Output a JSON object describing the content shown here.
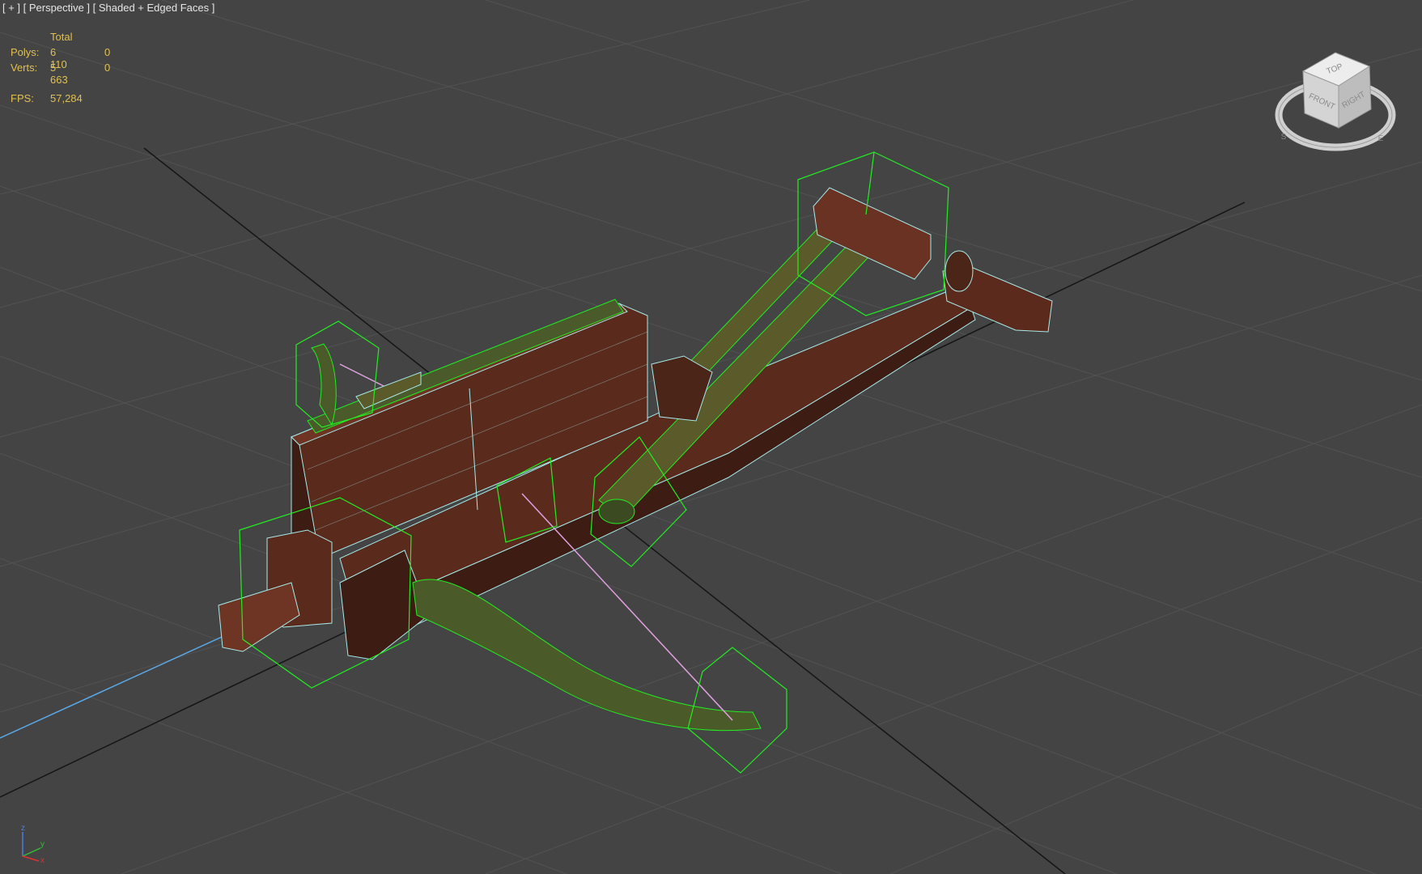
{
  "viewport": {
    "label": "[ + ] [ Perspective ] [ Shaded + Edged Faces ]",
    "label_parts": [
      "[ + ]",
      "[ Perspective ]",
      "[ Shaded + Edged Faces ]"
    ]
  },
  "stats": {
    "header": "Total",
    "polys_label": "Polys:",
    "polys_total": "6 110",
    "polys_selected": "0",
    "verts_label": "Verts:",
    "verts_total": "5 663",
    "verts_selected": "0",
    "fps_label": "FPS:",
    "fps_value": "57,284"
  },
  "viewcube": {
    "top": "TOP",
    "front": "FRONT",
    "right": "RIGHT",
    "compass_s": "S",
    "compass_e": "E"
  },
  "axis_tripod": {
    "x": "x",
    "y": "y",
    "z": "z"
  },
  "colors": {
    "background": "#444444",
    "grid": "#505050",
    "grid_main": "#111111",
    "wood_dark": "#4a2518",
    "wood": "#6e3524",
    "selection": "#22ee22",
    "edge": "#a8eaea",
    "stats_text": "#e0c050",
    "label_text": "#e6e6e6"
  }
}
